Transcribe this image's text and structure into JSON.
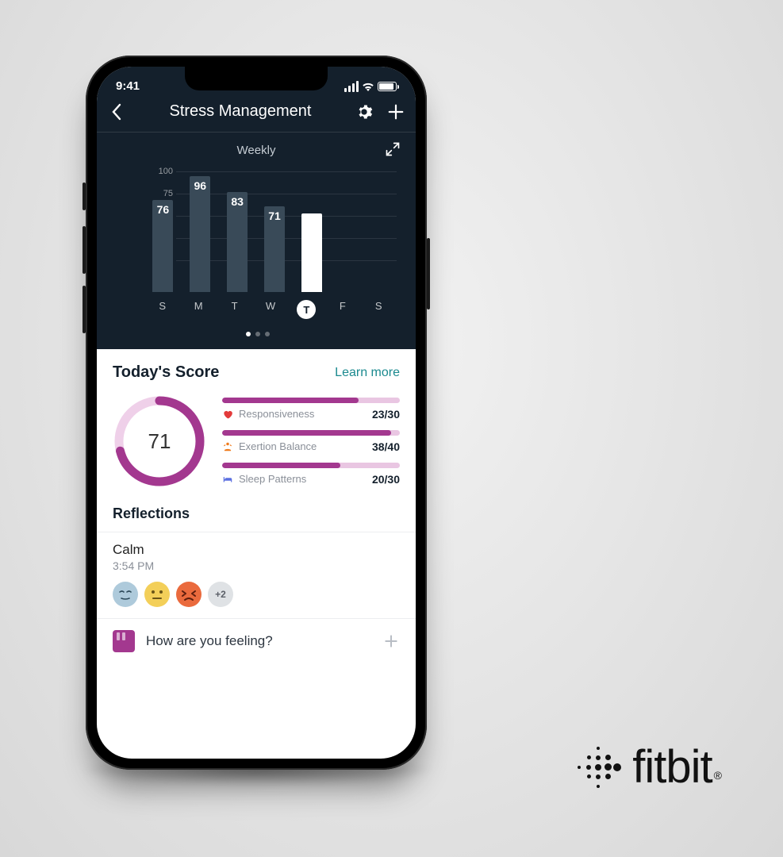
{
  "status": {
    "time": "9:41"
  },
  "nav": {
    "title": "Stress Management"
  },
  "chart": {
    "tab_label": "Weekly"
  },
  "chart_data": {
    "type": "bar",
    "categories": [
      "S",
      "M",
      "T",
      "W",
      "T",
      "F",
      "S"
    ],
    "values": [
      76,
      96,
      83,
      71,
      65,
      null,
      null
    ],
    "selected_index": 4,
    "ylim": [
      0,
      100
    ],
    "yticks": [
      0,
      25,
      50,
      75,
      100
    ],
    "show_label_on_selected": false
  },
  "score": {
    "title": "Today's Score",
    "learn_more": "Learn more",
    "value": "71",
    "ring_percent": 71,
    "metrics": [
      {
        "icon": "heart",
        "icon_color": "#e33b3b",
        "label": "Responsiveness",
        "value": 23,
        "max": 30
      },
      {
        "icon": "person",
        "icon_color": "#f07b1c",
        "label": "Exertion Balance",
        "value": 38,
        "max": 40
      },
      {
        "icon": "bed",
        "icon_color": "#5a6fe0",
        "label": "Sleep Patterns",
        "value": 20,
        "max": 30
      }
    ]
  },
  "reflections": {
    "title": "Reflections",
    "entry": {
      "title": "Calm",
      "time": "3:54 PM",
      "more": "+2"
    },
    "moods": [
      {
        "bg": "#aecadb",
        "face": "calm"
      },
      {
        "bg": "#f3cf59",
        "face": "neutral"
      },
      {
        "bg": "#ea6a3d",
        "face": "stressed"
      }
    ]
  },
  "feeling": {
    "prompt": "How are you feeling?"
  },
  "brand": {
    "name": "fitbit"
  },
  "colors": {
    "accent": "#a3388f",
    "accent_light": "#e9c6e2",
    "dark": "#14202c",
    "link": "#1b8a8f"
  }
}
